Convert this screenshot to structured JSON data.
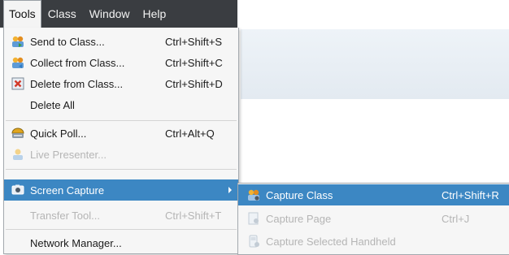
{
  "menubar": {
    "items": [
      "Tools",
      "Class",
      "Window",
      "Help"
    ]
  },
  "tools_menu": {
    "items": [
      {
        "label": "Send to Class...",
        "shortcut": "Ctrl+Shift+S",
        "icon": "send-to-class-icon"
      },
      {
        "label": "Collect from Class...",
        "shortcut": "Ctrl+Shift+C",
        "icon": "collect-from-class-icon"
      },
      {
        "label": "Delete from Class...",
        "shortcut": "Ctrl+Shift+D",
        "icon": "delete-from-class-icon"
      },
      {
        "label": "Delete All",
        "shortcut": ""
      },
      {
        "label": "Quick Poll...",
        "shortcut": "Ctrl+Alt+Q",
        "icon": "quick-poll-icon"
      },
      {
        "label": "Live Presenter...",
        "shortcut": "",
        "icon": "live-presenter-icon",
        "disabled": true
      },
      {
        "label": "Screen Capture",
        "shortcut": "",
        "icon": "screen-capture-icon",
        "selected": true,
        "has_submenu": true
      },
      {
        "label": "Transfer Tool...",
        "shortcut": "Ctrl+Shift+T",
        "disabled": true
      },
      {
        "label": "Network Manager...",
        "shortcut": ""
      }
    ]
  },
  "screen_capture_submenu": {
    "items": [
      {
        "label": "Capture Class",
        "shortcut": "Ctrl+Shift+R",
        "icon": "capture-class-icon",
        "selected": true
      },
      {
        "label": "Capture Page",
        "shortcut": "Ctrl+J",
        "icon": "capture-page-icon",
        "disabled": true
      },
      {
        "label": "Capture Selected Handheld",
        "shortcut": "",
        "icon": "capture-handheld-icon",
        "disabled": true
      }
    ]
  },
  "colors": {
    "menubar_bg": "#3a3d41",
    "selection": "#3c87c3",
    "menu_bg": "#f6f6f6",
    "disabled_text": "#b5b5b5"
  }
}
